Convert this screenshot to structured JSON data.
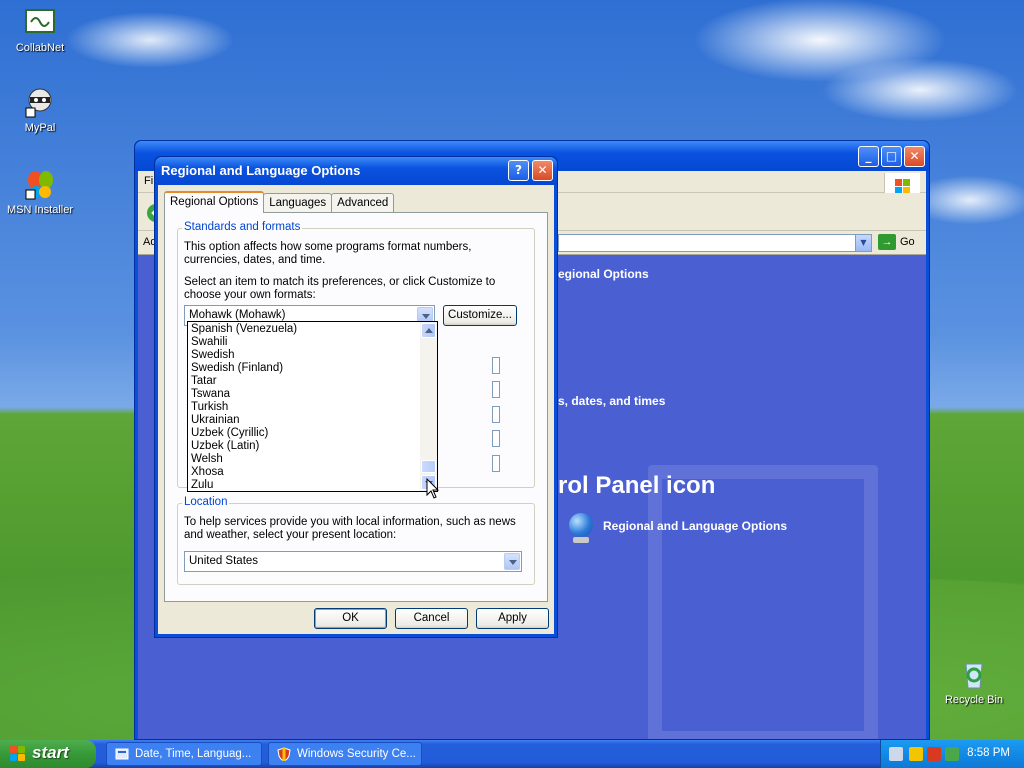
{
  "desktop": {
    "icons": [
      {
        "label": "CollabNet"
      },
      {
        "label": "MyPal"
      },
      {
        "label": "MSN Installer"
      },
      {
        "label": "Recycle Bin"
      }
    ]
  },
  "control_panel": {
    "menu_first_letter": "Fi",
    "address_prefix": "Ad",
    "go_label": "Go",
    "heading_options": "egional Options",
    "heading_formats": "s, dates, and times",
    "heading_icon": "rol Panel icon",
    "link_regional": "Regional and Language Options"
  },
  "dialog": {
    "title": "Regional and Language Options",
    "help_btn": "?",
    "close_btn": "✕",
    "tabs": [
      {
        "label": "Regional Options",
        "active": true
      },
      {
        "label": "Languages",
        "active": false
      },
      {
        "label": "Advanced",
        "active": false
      }
    ],
    "standards": {
      "group_label": "Standards and formats",
      "description": "This option affects how some programs format numbers, currencies, dates, and time.",
      "instruction": "Select an item to match its preferences, or click Customize to choose your own formats:",
      "selected": "Mohawk (Mohawk)",
      "customize_label": "Customize...",
      "list_items": [
        "Spanish (Venezuela)",
        "Swahili",
        "Swedish",
        "Swedish (Finland)",
        "Tatar",
        "Tswana",
        "Turkish",
        "Ukrainian",
        "Uzbek (Cyrillic)",
        "Uzbek (Latin)",
        "Welsh",
        "Xhosa",
        "Zulu"
      ]
    },
    "location": {
      "group_label": "Location",
      "description": "To help services provide you with local information, such as news and weather, select your present location:",
      "selected": "United States"
    },
    "buttons": {
      "ok": "OK",
      "cancel": "Cancel",
      "apply": "Apply"
    }
  },
  "taskbar": {
    "start_label": "start",
    "tasks": [
      {
        "label": "Date, Time, Languag..."
      },
      {
        "label": "Windows Security Ce..."
      }
    ],
    "clock": "8:58 PM"
  }
}
